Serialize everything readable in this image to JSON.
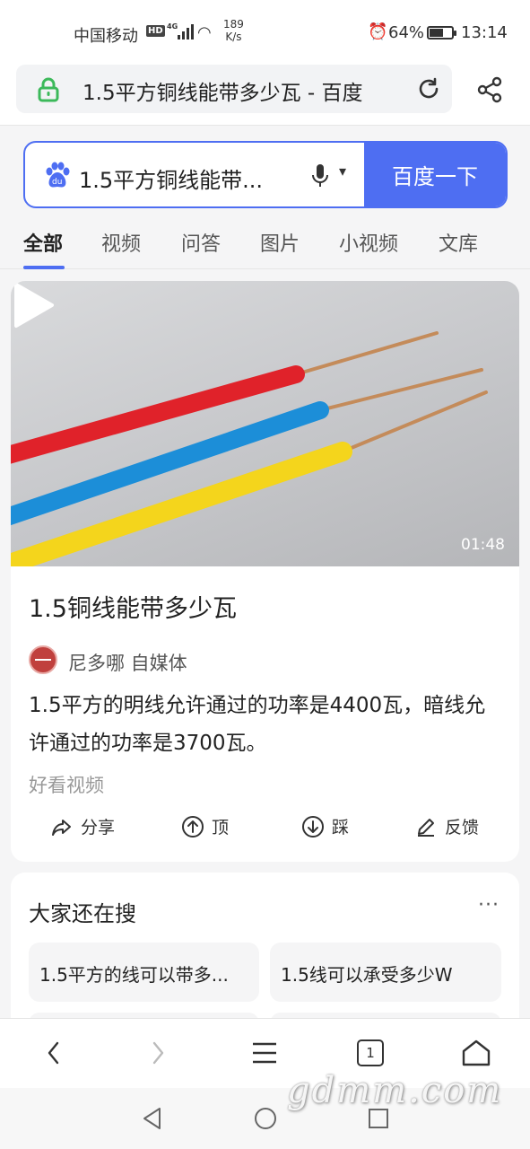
{
  "status_bar": {
    "carrier": "中国移动",
    "hd": "HD",
    "network": "4G",
    "speed_value": "189",
    "speed_unit": "K/s",
    "battery": "64%",
    "battery_level": 0.64,
    "time": "13:14"
  },
  "address_bar": {
    "title": "1.5平方铜线能带多少瓦 - 百度"
  },
  "search": {
    "query": "1.5平方铜线能带...",
    "button": "百度一下"
  },
  "tabs": [
    "全部",
    "视频",
    "问答",
    "图片",
    "小视频",
    "文库"
  ],
  "video_card": {
    "duration": "01:48",
    "title": "1.5铜线能带多少瓦",
    "author": "尼多哪 自媒体",
    "summary": "1.5平方的明线允许通过的功率是4400瓦，暗线允许通过的功率是3700瓦。",
    "source": "好看视频",
    "actions": {
      "share": "分享",
      "up": "顶",
      "down": "踩",
      "feedback": "反馈"
    }
  },
  "related": {
    "title": "大家还在搜",
    "more": "···",
    "chips": [
      "1.5平方的线可以带多...",
      "1.5线可以承受多少W"
    ]
  },
  "bottom_nav": {
    "tab_count": "1"
  },
  "watermark": "gdmm.com",
  "colors": {
    "accent": "#4e6ef2",
    "lock": "#3cb95a"
  }
}
